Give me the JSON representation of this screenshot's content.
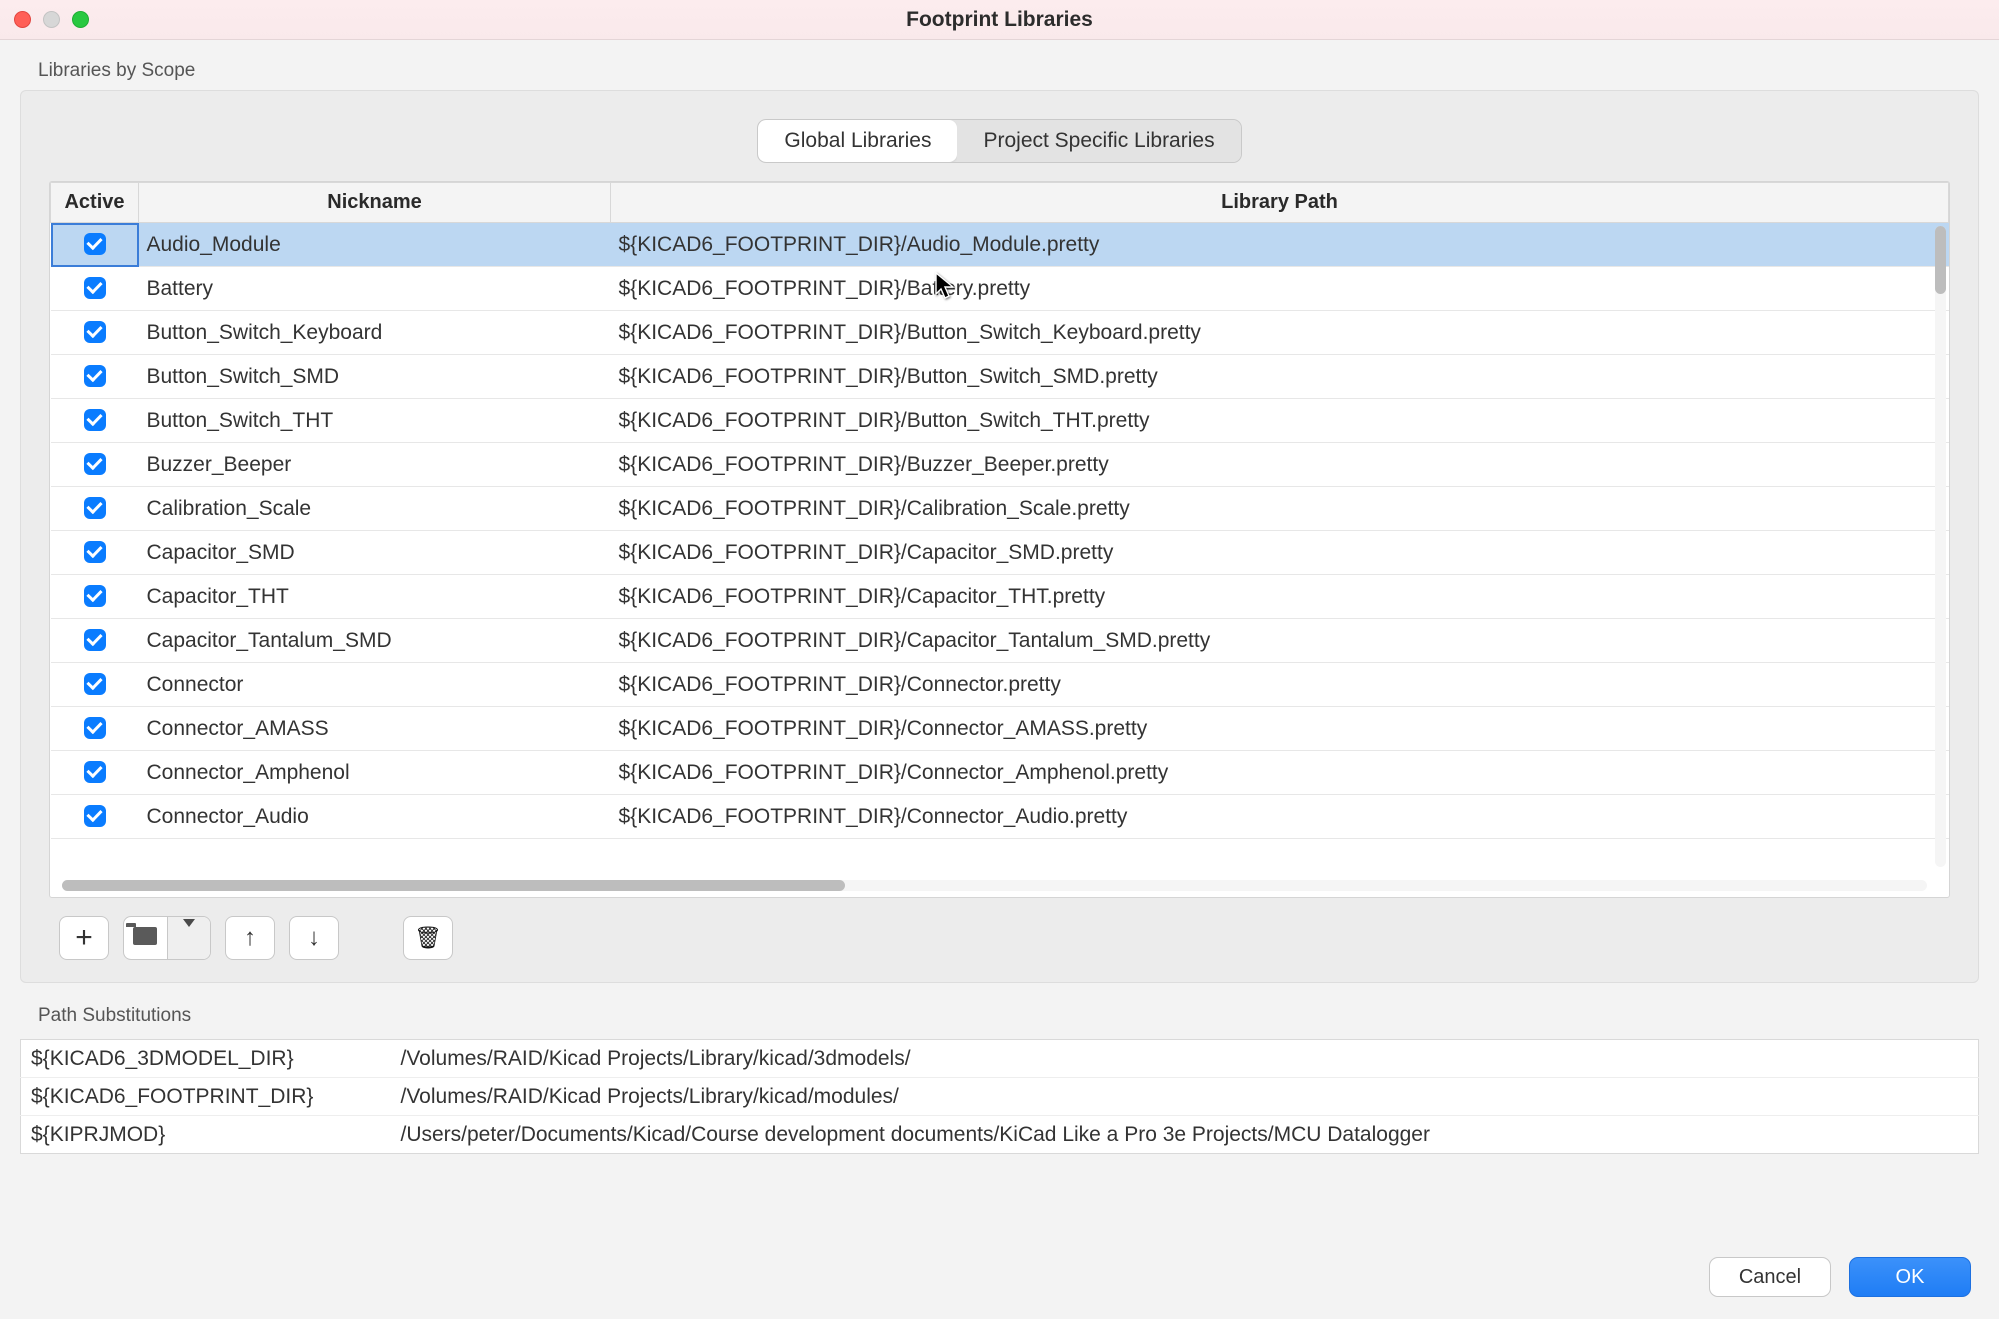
{
  "title": "Footprint Libraries",
  "groupLabel": "Libraries by Scope",
  "tabs": {
    "global": "Global Libraries",
    "project": "Project Specific Libraries"
  },
  "columns": {
    "active": "Active",
    "nickname": "Nickname",
    "path": "Library Path"
  },
  "rows": [
    {
      "nick": "Audio_Module",
      "path": "${KICAD6_FOOTPRINT_DIR}/Audio_Module.pretty"
    },
    {
      "nick": "Battery",
      "path": "${KICAD6_FOOTPRINT_DIR}/Battery.pretty"
    },
    {
      "nick": "Button_Switch_Keyboard",
      "path": "${KICAD6_FOOTPRINT_DIR}/Button_Switch_Keyboard.pretty"
    },
    {
      "nick": "Button_Switch_SMD",
      "path": "${KICAD6_FOOTPRINT_DIR}/Button_Switch_SMD.pretty"
    },
    {
      "nick": "Button_Switch_THT",
      "path": "${KICAD6_FOOTPRINT_DIR}/Button_Switch_THT.pretty"
    },
    {
      "nick": "Buzzer_Beeper",
      "path": "${KICAD6_FOOTPRINT_DIR}/Buzzer_Beeper.pretty"
    },
    {
      "nick": "Calibration_Scale",
      "path": "${KICAD6_FOOTPRINT_DIR}/Calibration_Scale.pretty"
    },
    {
      "nick": "Capacitor_SMD",
      "path": "${KICAD6_FOOTPRINT_DIR}/Capacitor_SMD.pretty"
    },
    {
      "nick": "Capacitor_THT",
      "path": "${KICAD6_FOOTPRINT_DIR}/Capacitor_THT.pretty"
    },
    {
      "nick": "Capacitor_Tantalum_SMD",
      "path": "${KICAD6_FOOTPRINT_DIR}/Capacitor_Tantalum_SMD.pretty"
    },
    {
      "nick": "Connector",
      "path": "${KICAD6_FOOTPRINT_DIR}/Connector.pretty"
    },
    {
      "nick": "Connector_AMASS",
      "path": "${KICAD6_FOOTPRINT_DIR}/Connector_AMASS.pretty"
    },
    {
      "nick": "Connector_Amphenol",
      "path": "${KICAD6_FOOTPRINT_DIR}/Connector_Amphenol.pretty"
    },
    {
      "nick": "Connector_Audio",
      "path": "${KICAD6_FOOTPRINT_DIR}/Connector_Audio.pretty"
    }
  ],
  "pathSubLabel": "Path Substitutions",
  "pathSubs": [
    {
      "var": "${KICAD6_3DMODEL_DIR}",
      "val": "/Volumes/RAID/Kicad Projects/Library/kicad/3dmodels/"
    },
    {
      "var": "${KICAD6_FOOTPRINT_DIR}",
      "val": "/Volumes/RAID/Kicad Projects/Library/kicad/modules/"
    },
    {
      "var": "${KIPRJMOD}",
      "val": "/Users/peter/Documents/Kicad/Course development documents/KiCad Like a Pro 3e Projects/MCU Datalogger"
    }
  ],
  "buttons": {
    "cancel": "Cancel",
    "ok": "OK"
  }
}
